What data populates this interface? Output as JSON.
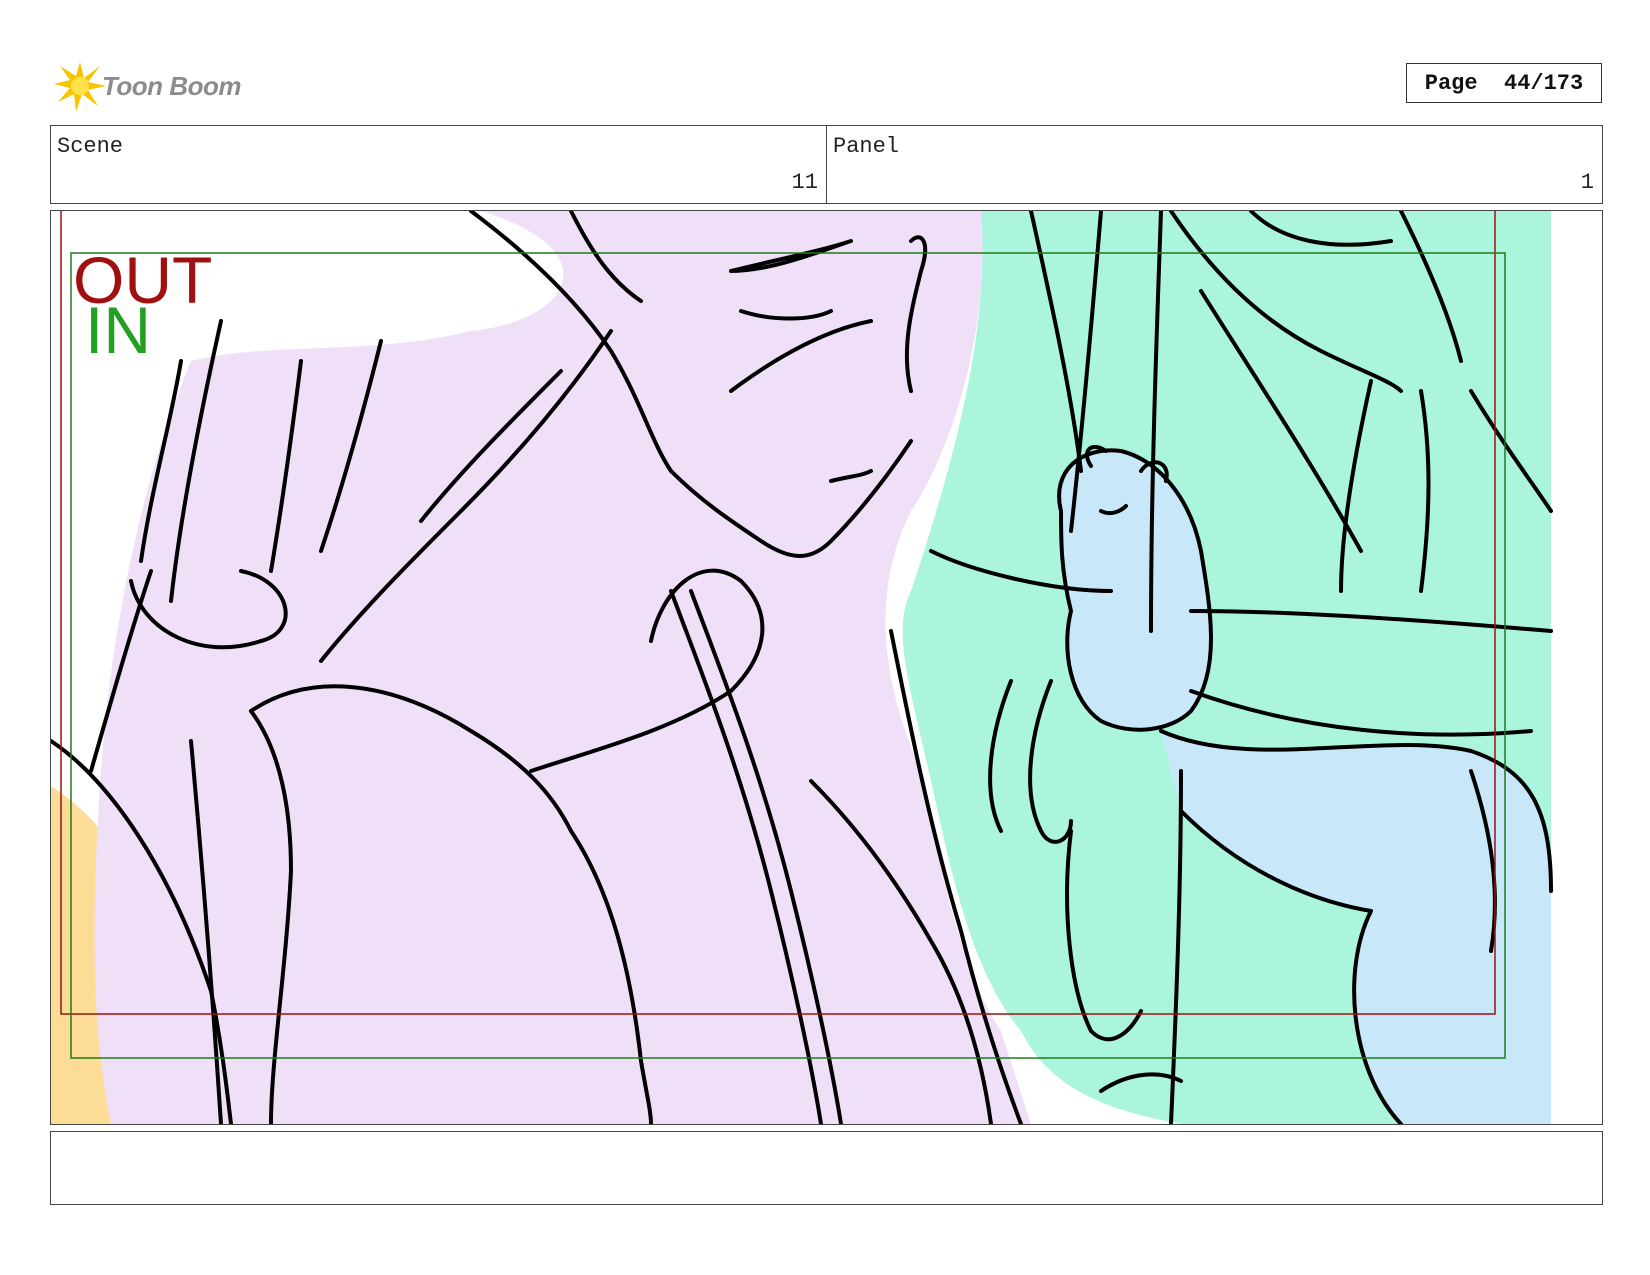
{
  "header": {
    "logo_text": "Toon Boom",
    "page_label": "Page",
    "page_value": "44/173"
  },
  "info": {
    "scene_label": "Scene",
    "scene_value": "11",
    "panel_label": "Panel",
    "panel_value": "1"
  },
  "panel": {
    "out_label": "OUT",
    "in_label": "IN",
    "colors": {
      "out_frame": "#a01010",
      "in_frame": "#1e7a1e",
      "in_text": "#22a022",
      "skin": "#efe0f8",
      "hair": "#aaf5dc",
      "mouse": "#c8e8fa",
      "shoulder": "#fddc96",
      "line": "#000000"
    }
  },
  "notes": {
    "text": ""
  }
}
